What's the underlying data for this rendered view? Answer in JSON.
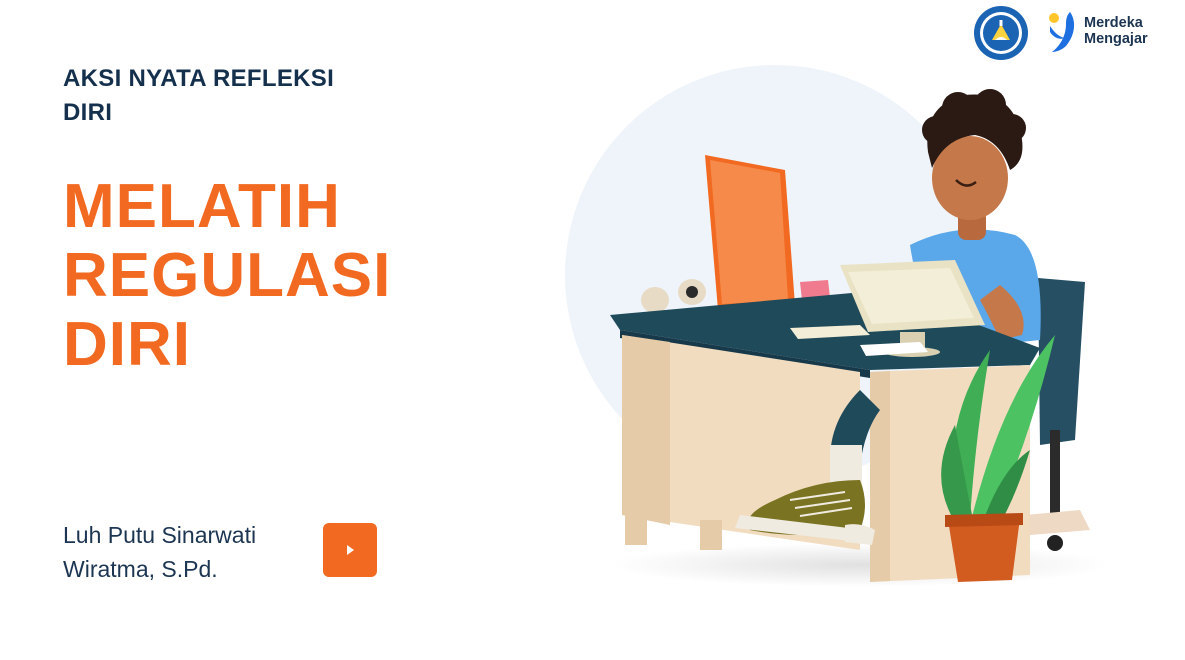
{
  "header": {
    "logos": {
      "kemdikbud": {
        "icon": "tut-wuri-handayani-emblem-icon"
      },
      "merdeka_mengajar": {
        "icon": "merdeka-mengajar-logo-icon",
        "line1": "Merdeka",
        "line2": "Mengajar"
      }
    }
  },
  "content": {
    "subtitle_line1": "AKSI NYATA REFLEKSI",
    "subtitle_line2": "DIRI",
    "title_line1": "MELATIH",
    "title_line2": "REGULASI",
    "title_line3": "DIRI",
    "author_line1": "Luh Putu Sinarwati",
    "author_line2": "Wiratma, S.Pd.",
    "play_button_icon": "play-icon"
  },
  "illustration": {
    "icon": "person-at-computer-desk-illustration"
  },
  "colors": {
    "accent": "#f26a21",
    "navy": "#14304d",
    "circle_bg": "#eef4f9",
    "desk_top": "#1f4a5a",
    "desk_body": "#f2dcc0",
    "shirt": "#5aa7ea",
    "plant": "#3fae55"
  }
}
